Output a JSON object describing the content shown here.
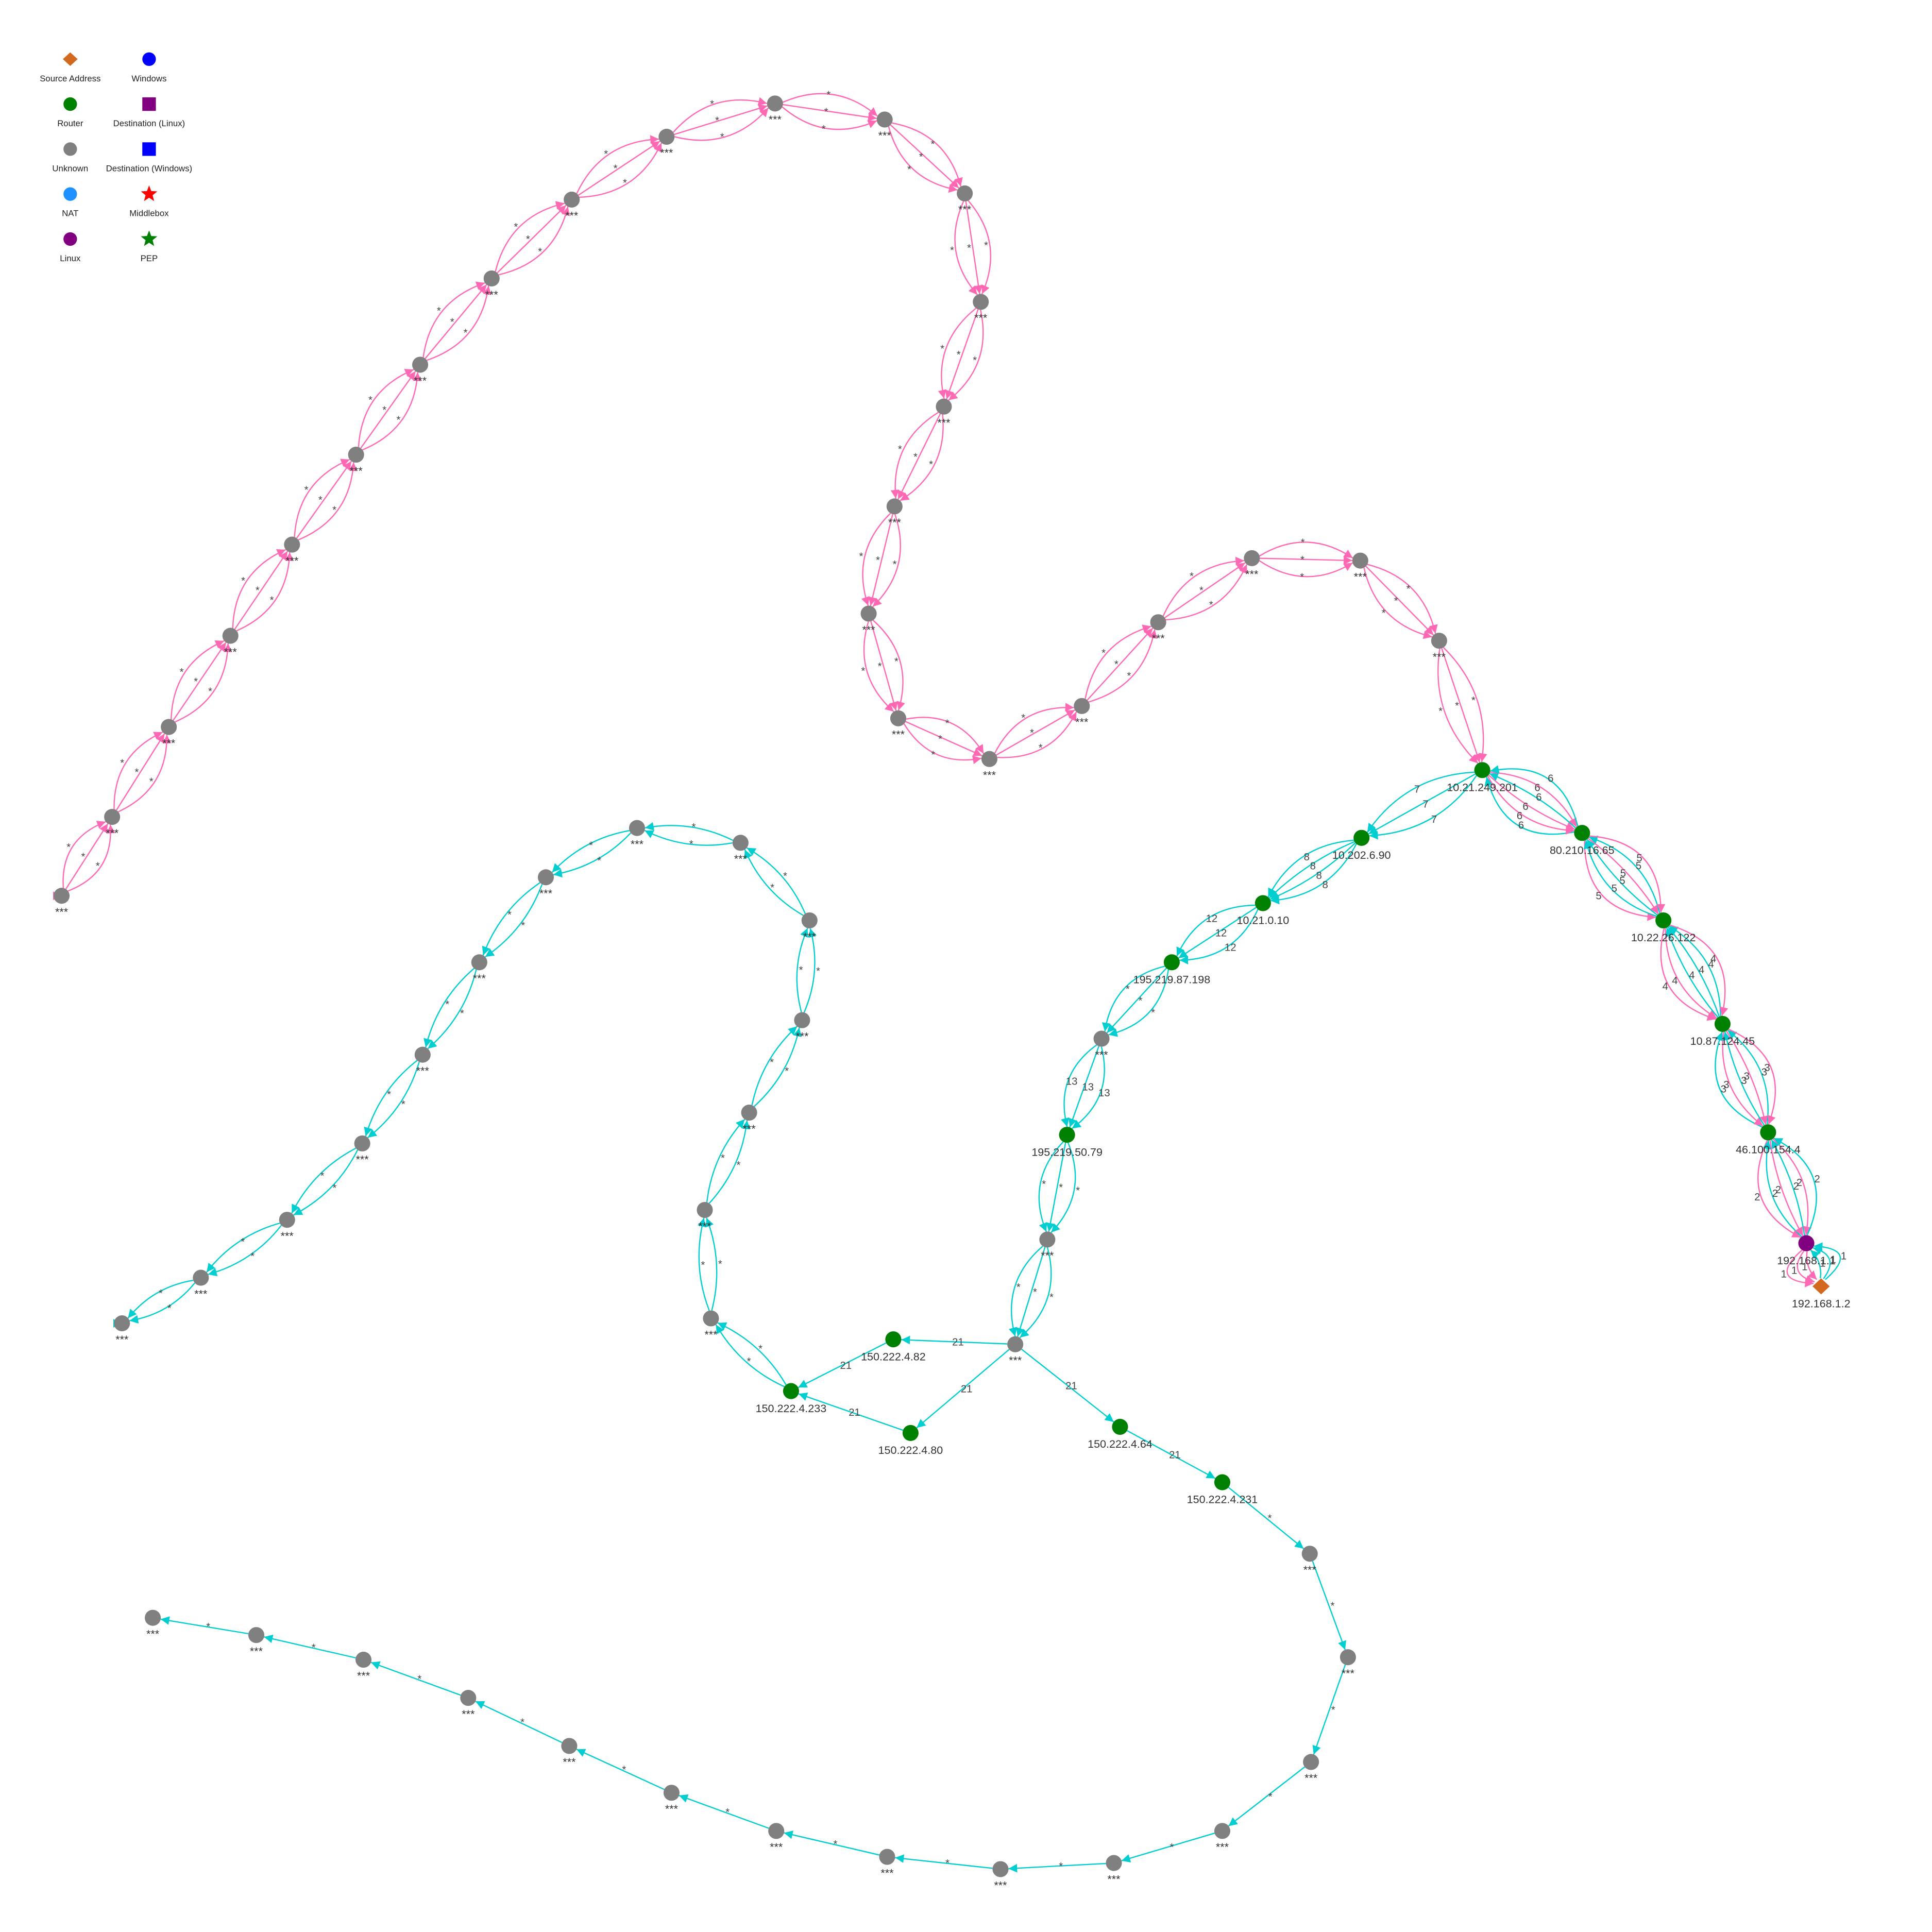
{
  "legend": [
    {
      "label": "Source Address",
      "shape": "diamond",
      "color": "#D2691E"
    },
    {
      "label": "Windows",
      "shape": "circle",
      "color": "#0000FF"
    },
    {
      "label": "Router",
      "shape": "circle",
      "color": "#008000"
    },
    {
      "label": "Destination (Linux)",
      "shape": "square",
      "color": "#800080"
    },
    {
      "label": "Unknown",
      "shape": "circle",
      "color": "#808080"
    },
    {
      "label": "Destination (Windows)",
      "shape": "square",
      "color": "#0000FF"
    },
    {
      "label": "NAT",
      "shape": "circle",
      "color": "#1E90FF"
    },
    {
      "label": "Middlebox",
      "shape": "star",
      "color": "#FF0000"
    },
    {
      "label": "Linux",
      "shape": "circle",
      "color": "#800080"
    },
    {
      "label": "PEP",
      "shape": "star",
      "color": "#008000"
    }
  ],
  "colors": {
    "path_a": "#FF69B4",
    "path_b": "#00CED1",
    "router": "#008000",
    "unknown": "#808080",
    "linux": "#800080",
    "source": "#D2691E"
  },
  "nodes": [
    {
      "id": "src",
      "label": "192.168.1.2",
      "type": "source"
    },
    {
      "id": "gw",
      "label": "192.168.1.1",
      "type": "linux"
    },
    {
      "id": "r1",
      "label": "46.100.154.4",
      "type": "router"
    },
    {
      "id": "r2",
      "label": "10.87.124.45",
      "type": "router"
    },
    {
      "id": "r3",
      "label": "10.22.26.122",
      "type": "router"
    },
    {
      "id": "r4",
      "label": "80.210.16.65",
      "type": "router"
    },
    {
      "id": "r5",
      "label": "10.21.249.201",
      "type": "router"
    },
    {
      "id": "r6",
      "label": "10.202.6.90",
      "type": "router"
    },
    {
      "id": "r7",
      "label": "10.21.0.10",
      "type": "router"
    },
    {
      "id": "r8",
      "label": "195.219.87.198",
      "type": "router"
    },
    {
      "id": "u1",
      "label": "***",
      "type": "unknown"
    },
    {
      "id": "r9",
      "label": "195.219.50.79",
      "type": "router"
    },
    {
      "id": "u2",
      "label": "***",
      "type": "unknown"
    },
    {
      "id": "u3",
      "label": "***",
      "type": "unknown"
    },
    {
      "id": "r10",
      "label": "150.222.4.82",
      "type": "router"
    },
    {
      "id": "r11",
      "label": "150.222.4.80",
      "type": "router"
    },
    {
      "id": "r12",
      "label": "150.222.4.233",
      "type": "router"
    },
    {
      "id": "r13",
      "label": "150.222.4.64",
      "type": "router"
    },
    {
      "id": "r14",
      "label": "150.222.4.231",
      "type": "router"
    },
    {
      "id": "p1",
      "label": "***",
      "type": "unknown"
    },
    {
      "id": "p2",
      "label": "***",
      "type": "unknown"
    },
    {
      "id": "p3",
      "label": "***",
      "type": "unknown"
    },
    {
      "id": "p4",
      "label": "***",
      "type": "unknown"
    },
    {
      "id": "p5",
      "label": "***",
      "type": "unknown"
    },
    {
      "id": "p6",
      "label": "***",
      "type": "unknown"
    },
    {
      "id": "p7",
      "label": "***",
      "type": "unknown"
    },
    {
      "id": "p8",
      "label": "***",
      "type": "unknown"
    },
    {
      "id": "p9",
      "label": "***",
      "type": "unknown"
    },
    {
      "id": "p10",
      "label": "***",
      "type": "unknown"
    },
    {
      "id": "p11",
      "label": "***",
      "type": "unknown"
    },
    {
      "id": "p12",
      "label": "***",
      "type": "unknown"
    },
    {
      "id": "p13",
      "label": "***",
      "type": "unknown"
    },
    {
      "id": "p14",
      "label": "***",
      "type": "unknown"
    },
    {
      "id": "p15",
      "label": "***",
      "type": "unknown"
    },
    {
      "id": "p16",
      "label": "***",
      "type": "unknown"
    },
    {
      "id": "p17",
      "label": "***",
      "type": "unknown"
    },
    {
      "id": "p18",
      "label": "***",
      "type": "unknown"
    },
    {
      "id": "p19",
      "label": "***",
      "type": "unknown"
    },
    {
      "id": "p20",
      "label": "***",
      "type": "unknown"
    },
    {
      "id": "p21",
      "label": "***",
      "type": "unknown"
    },
    {
      "id": "p22",
      "label": "***",
      "type": "unknown"
    },
    {
      "id": "p23",
      "label": "***",
      "type": "unknown"
    },
    {
      "id": "p24",
      "label": "***",
      "type": "unknown"
    },
    {
      "id": "p25",
      "label": "***",
      "type": "unknown"
    },
    {
      "id": "c1",
      "label": "***",
      "type": "unknown"
    },
    {
      "id": "c2",
      "label": "***",
      "type": "unknown"
    },
    {
      "id": "c3",
      "label": "***",
      "type": "unknown"
    },
    {
      "id": "c4",
      "label": "***",
      "type": "unknown"
    },
    {
      "id": "c5",
      "label": "***",
      "type": "unknown"
    },
    {
      "id": "c6",
      "label": "***",
      "type": "unknown"
    },
    {
      "id": "c7",
      "label": "***",
      "type": "unknown"
    },
    {
      "id": "c8",
      "label": "***",
      "type": "unknown"
    },
    {
      "id": "c9",
      "label": "***",
      "type": "unknown"
    },
    {
      "id": "c10",
      "label": "***",
      "type": "unknown"
    },
    {
      "id": "c11",
      "label": "***",
      "type": "unknown"
    },
    {
      "id": "c12",
      "label": "***",
      "type": "unknown"
    },
    {
      "id": "c13",
      "label": "***",
      "type": "unknown"
    },
    {
      "id": "c14",
      "label": "***",
      "type": "unknown"
    },
    {
      "id": "c15",
      "label": "***",
      "type": "unknown"
    },
    {
      "id": "d1",
      "label": "***",
      "type": "unknown"
    },
    {
      "id": "d2",
      "label": "***",
      "type": "unknown"
    },
    {
      "id": "d3",
      "label": "***",
      "type": "unknown"
    },
    {
      "id": "d4",
      "label": "***",
      "type": "unknown"
    },
    {
      "id": "d5",
      "label": "***",
      "type": "unknown"
    },
    {
      "id": "d6",
      "label": "***",
      "type": "unknown"
    },
    {
      "id": "d7",
      "label": "***",
      "type": "unknown"
    },
    {
      "id": "d8",
      "label": "***",
      "type": "unknown"
    },
    {
      "id": "d9",
      "label": "***",
      "type": "unknown"
    },
    {
      "id": "d10",
      "label": "***",
      "type": "unknown"
    },
    {
      "id": "d11",
      "label": "***",
      "type": "unknown"
    },
    {
      "id": "d12",
      "label": "***",
      "type": "unknown"
    },
    {
      "id": "d13",
      "label": "***",
      "type": "unknown"
    },
    {
      "id": "d14",
      "label": "***",
      "type": "unknown"
    }
  ],
  "edge_groups": [
    {
      "from": "src",
      "to": "gw",
      "label": "1",
      "colors": [
        "a",
        "a",
        "a",
        "b",
        "b",
        "b"
      ]
    },
    {
      "from": "gw",
      "to": "r1",
      "label": "2",
      "colors": [
        "a",
        "b",
        "a",
        "b",
        "a",
        "b"
      ]
    },
    {
      "from": "r1",
      "to": "r2",
      "label": "3",
      "colors": [
        "b",
        "a",
        "b",
        "a",
        "b",
        "a"
      ]
    },
    {
      "from": "r2",
      "to": "r3",
      "label": "4",
      "colors": [
        "a",
        "a",
        "b",
        "b",
        "b",
        "a"
      ]
    },
    {
      "from": "r3",
      "to": "r4",
      "label": "5",
      "colors": [
        "a",
        "b",
        "b",
        "a",
        "b",
        "a"
      ]
    },
    {
      "from": "r4",
      "to": "r5",
      "label": "6",
      "colors": [
        "b",
        "a",
        "a",
        "b",
        "a",
        "b"
      ]
    },
    {
      "from": "r5",
      "to": "r6",
      "label": "7",
      "colors": [
        "b",
        "b",
        "b"
      ]
    },
    {
      "from": "r6",
      "to": "r7",
      "label": "8",
      "colors": [
        "b",
        "b",
        "b",
        "b"
      ]
    },
    {
      "from": "r7",
      "to": "r8",
      "label": "12",
      "colors": [
        "b",
        "b",
        "b"
      ]
    },
    {
      "from": "r8",
      "to": "u1",
      "label": "*",
      "colors": [
        "b",
        "b",
        "b"
      ]
    },
    {
      "from": "u1",
      "to": "r9",
      "label": "13",
      "colors": [
        "b",
        "b",
        "b"
      ]
    },
    {
      "from": "r9",
      "to": "u2",
      "label": "*",
      "colors": [
        "b",
        "b",
        "b"
      ]
    },
    {
      "from": "u2",
      "to": "u3",
      "label": "*",
      "colors": [
        "b",
        "b",
        "b"
      ]
    },
    {
      "from": "u3",
      "to": "r10",
      "label": "21",
      "colors": [
        "b"
      ]
    },
    {
      "from": "u3",
      "to": "r11",
      "label": "21",
      "colors": [
        "b"
      ]
    },
    {
      "from": "u3",
      "to": "r13",
      "label": "21",
      "colors": [
        "b"
      ]
    },
    {
      "from": "r10",
      "to": "r12",
      "label": "21",
      "colors": [
        "b"
      ]
    },
    {
      "from": "r11",
      "to": "r12",
      "label": "21",
      "colors": [
        "b"
      ]
    },
    {
      "from": "r13",
      "to": "r14",
      "label": "21",
      "colors": [
        "b"
      ]
    },
    {
      "from": "r5",
      "to": "p1",
      "label": "*",
      "colors": [
        "a",
        "a",
        "a"
      ]
    },
    {
      "from": "p1",
      "to": "p2",
      "label": "*",
      "colors": [
        "a",
        "a",
        "a"
      ]
    },
    {
      "from": "p2",
      "to": "p3",
      "label": "*",
      "colors": [
        "a",
        "a",
        "a"
      ]
    },
    {
      "from": "p3",
      "to": "p4",
      "label": "*",
      "colors": [
        "a",
        "a",
        "a"
      ]
    },
    {
      "from": "p4",
      "to": "p5",
      "label": "*",
      "colors": [
        "a",
        "a",
        "a"
      ]
    },
    {
      "from": "p5",
      "to": "p6",
      "label": "*",
      "colors": [
        "a",
        "a",
        "a"
      ]
    },
    {
      "from": "p6",
      "to": "p7",
      "label": "*",
      "colors": [
        "a",
        "a",
        "a"
      ]
    },
    {
      "from": "p7",
      "to": "p8",
      "label": "*",
      "colors": [
        "a",
        "a",
        "a"
      ]
    },
    {
      "from": "p8",
      "to": "p9",
      "label": "*",
      "colors": [
        "a",
        "a",
        "a"
      ]
    },
    {
      "from": "p9",
      "to": "p10",
      "label": "*",
      "colors": [
        "a",
        "a",
        "a"
      ]
    },
    {
      "from": "p10",
      "to": "p11",
      "label": "*",
      "colors": [
        "a",
        "a",
        "a"
      ]
    },
    {
      "from": "p11",
      "to": "p12",
      "label": "*",
      "colors": [
        "a",
        "a",
        "a"
      ]
    },
    {
      "from": "p12",
      "to": "p13",
      "label": "*",
      "colors": [
        "a",
        "a",
        "a"
      ]
    },
    {
      "from": "p13",
      "to": "p14",
      "label": "*",
      "colors": [
        "a",
        "a",
        "a"
      ]
    },
    {
      "from": "p14",
      "to": "p15",
      "label": "*",
      "colors": [
        "a",
        "a",
        "a"
      ]
    },
    {
      "from": "p15",
      "to": "p16",
      "label": "*",
      "colors": [
        "a",
        "a",
        "a"
      ]
    },
    {
      "from": "p16",
      "to": "p17",
      "label": "*",
      "colors": [
        "a",
        "a",
        "a"
      ]
    },
    {
      "from": "p17",
      "to": "p18",
      "label": "*",
      "colors": [
        "a",
        "a",
        "a"
      ]
    },
    {
      "from": "p18",
      "to": "p19",
      "label": "*",
      "colors": [
        "a",
        "a",
        "a"
      ]
    },
    {
      "from": "p19",
      "to": "p20",
      "label": "*",
      "colors": [
        "a",
        "a",
        "a"
      ]
    },
    {
      "from": "p20",
      "to": "p21",
      "label": "*",
      "colors": [
        "a",
        "a",
        "a"
      ]
    },
    {
      "from": "p21",
      "to": "p22",
      "label": "*",
      "colors": [
        "a",
        "a",
        "a"
      ]
    },
    {
      "from": "p22",
      "to": "p23",
      "label": "*",
      "colors": [
        "a",
        "a",
        "a"
      ]
    },
    {
      "from": "p23",
      "to": "p24",
      "label": "*",
      "colors": [
        "a",
        "a",
        "a"
      ]
    },
    {
      "from": "p24",
      "to": "p25",
      "label": "*",
      "colors": [
        "a",
        "a",
        "a"
      ]
    },
    {
      "from": "r12",
      "to": "c1",
      "label": "*",
      "colors": [
        "b",
        "b"
      ]
    },
    {
      "from": "c1",
      "to": "c2",
      "label": "*",
      "colors": [
        "b",
        "b"
      ]
    },
    {
      "from": "c2",
      "to": "c3",
      "label": "*",
      "colors": [
        "b",
        "b"
      ]
    },
    {
      "from": "c3",
      "to": "c4",
      "label": "*",
      "colors": [
        "b",
        "b"
      ]
    },
    {
      "from": "c4",
      "to": "c5",
      "label": "*",
      "colors": [
        "b",
        "b"
      ]
    },
    {
      "from": "c5",
      "to": "c6",
      "label": "*",
      "colors": [
        "b",
        "b"
      ]
    },
    {
      "from": "c6",
      "to": "c7",
      "label": "*",
      "colors": [
        "b",
        "b"
      ]
    },
    {
      "from": "c7",
      "to": "c8",
      "label": "*",
      "colors": [
        "b",
        "b"
      ]
    },
    {
      "from": "c8",
      "to": "c9",
      "label": "*",
      "colors": [
        "b",
        "b"
      ]
    },
    {
      "from": "c9",
      "to": "c10",
      "label": "*",
      "colors": [
        "b",
        "b"
      ]
    },
    {
      "from": "c10",
      "to": "c11",
      "label": "*",
      "colors": [
        "b",
        "b"
      ]
    },
    {
      "from": "c11",
      "to": "c12",
      "label": "*",
      "colors": [
        "b",
        "b"
      ]
    },
    {
      "from": "c12",
      "to": "c13",
      "label": "*",
      "colors": [
        "b",
        "b"
      ]
    },
    {
      "from": "c13",
      "to": "c14",
      "label": "*",
      "colors": [
        "b",
        "b"
      ]
    },
    {
      "from": "c14",
      "to": "c15",
      "label": "*",
      "colors": [
        "b",
        "b"
      ]
    },
    {
      "from": "r14",
      "to": "d1",
      "label": "*",
      "colors": [
        "b"
      ]
    },
    {
      "from": "d1",
      "to": "d2",
      "label": "*",
      "colors": [
        "b"
      ]
    },
    {
      "from": "d2",
      "to": "d3",
      "label": "*",
      "colors": [
        "b"
      ]
    },
    {
      "from": "d3",
      "to": "d4",
      "label": "*",
      "colors": [
        "b"
      ]
    },
    {
      "from": "d4",
      "to": "d5",
      "label": "*",
      "colors": [
        "b"
      ]
    },
    {
      "from": "d5",
      "to": "d6",
      "label": "*",
      "colors": [
        "b"
      ]
    },
    {
      "from": "d6",
      "to": "d7",
      "label": "*",
      "colors": [
        "b"
      ]
    },
    {
      "from": "d7",
      "to": "d8",
      "label": "*",
      "colors": [
        "b"
      ]
    },
    {
      "from": "d8",
      "to": "d9",
      "label": "*",
      "colors": [
        "b"
      ]
    },
    {
      "from": "d9",
      "to": "d10",
      "label": "*",
      "colors": [
        "b"
      ]
    },
    {
      "from": "d10",
      "to": "d11",
      "label": "*",
      "colors": [
        "b"
      ]
    },
    {
      "from": "d11",
      "to": "d12",
      "label": "*",
      "colors": [
        "b"
      ]
    },
    {
      "from": "d12",
      "to": "d13",
      "label": "*",
      "colors": [
        "b"
      ]
    },
    {
      "from": "d13",
      "to": "d14",
      "label": "*",
      "colors": [
        "b"
      ]
    }
  ]
}
